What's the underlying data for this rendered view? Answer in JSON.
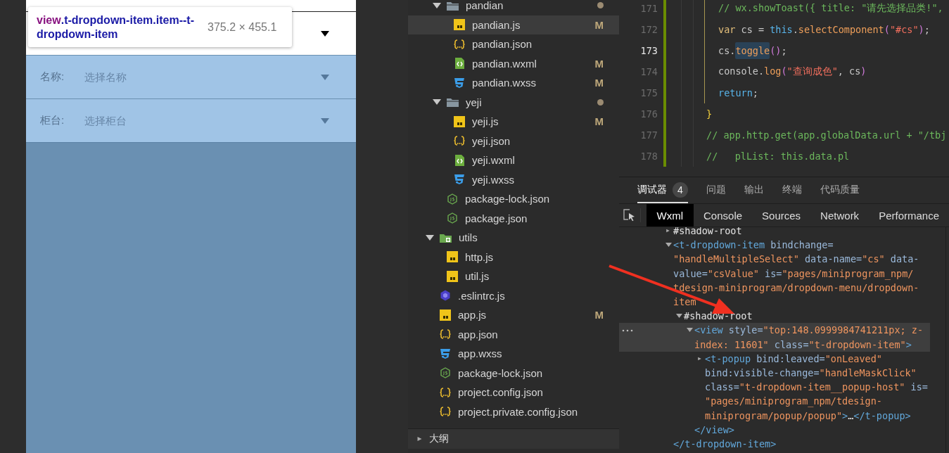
{
  "simulator": {
    "tooltip": {
      "tag": "view",
      "classes": ".t-dropdown-item.item--t-dropdown-item",
      "size": "375.2 × 455.1"
    },
    "fields": [
      {
        "label": "名称:",
        "placeholder": "选择名称"
      },
      {
        "label": "柜台:",
        "placeholder": "选择柜台"
      }
    ]
  },
  "file_tree": {
    "nested_items": [
      {
        "name": "pandian",
        "kind": "folder",
        "expanded": true,
        "modified": true,
        "selected": false,
        "children": [
          {
            "name": "pandian.js",
            "kind": "js",
            "status": "M",
            "selected": true
          },
          {
            "name": "pandian.json",
            "kind": "json",
            "selected": false
          },
          {
            "name": "pandian.wxml",
            "kind": "wxml",
            "status": "M",
            "selected": false
          },
          {
            "name": "pandian.wxss",
            "kind": "wxss",
            "status": "M",
            "selected": false
          }
        ]
      },
      {
        "name": "yeji",
        "kind": "folder",
        "expanded": true,
        "modified": true,
        "selected": false,
        "children": [
          {
            "name": "yeji.js",
            "kind": "js",
            "status": "M",
            "selected": false
          },
          {
            "name": "yeji.json",
            "kind": "json",
            "selected": false
          },
          {
            "name": "yeji.wxml",
            "kind": "wxml",
            "selected": false
          },
          {
            "name": "yeji.wxss",
            "kind": "wxss",
            "selected": false
          }
        ]
      },
      {
        "name": "package-lock.json",
        "kind": "node",
        "selected": false
      },
      {
        "name": "package.json",
        "kind": "node",
        "selected": false
      }
    ],
    "root_items": [
      {
        "name": "utils",
        "kind": "library-folder",
        "expanded": true,
        "modified": false,
        "selected": false,
        "children": [
          {
            "name": "http.js",
            "kind": "js",
            "selected": false
          },
          {
            "name": "util.js",
            "kind": "js",
            "selected": false
          }
        ]
      },
      {
        "name": ".eslintrc.js",
        "kind": "eslint",
        "selected": false
      },
      {
        "name": "app.js",
        "kind": "js",
        "status": "M",
        "selected": false
      },
      {
        "name": "app.json",
        "kind": "json",
        "selected": false
      },
      {
        "name": "app.wxss",
        "kind": "wxss",
        "selected": false
      },
      {
        "name": "package-lock.json",
        "kind": "node",
        "selected": false
      },
      {
        "name": "project.config.json",
        "kind": "json",
        "selected": false
      },
      {
        "name": "project.private.config.json",
        "kind": "json",
        "selected": false
      }
    ],
    "outline": {
      "label": "大纲",
      "expanded": false
    }
  },
  "editor": {
    "lines": [
      {
        "number": "171",
        "current": false,
        "kind": "inner",
        "tokens": [
          {
            "kind": "comment",
            "text": "// wx.showToast({ title: \"请先选择品类!\","
          }
        ]
      },
      {
        "number": "172",
        "current": false,
        "kind": "inner",
        "tokens": [
          {
            "kind": "keyword",
            "text": "var"
          },
          {
            "kind": "plain",
            "text": " cs = "
          },
          {
            "kind": "this",
            "text": "this"
          },
          {
            "kind": "plain",
            "text": "."
          },
          {
            "kind": "func",
            "text": "selectComponent"
          },
          {
            "kind": "paren",
            "text": "("
          },
          {
            "kind": "string",
            "text": "\"#cs\""
          },
          {
            "kind": "paren",
            "text": ")"
          },
          {
            "kind": "plain",
            "text": ";"
          }
        ]
      },
      {
        "number": "173",
        "current": true,
        "kind": "inner",
        "tokens": [
          {
            "kind": "plain",
            "text": "cs."
          },
          {
            "kind": "match",
            "text": "toggle"
          },
          {
            "kind": "paren",
            "text": "()"
          },
          {
            "kind": "plain",
            "text": ";"
          }
        ]
      },
      {
        "number": "174",
        "current": false,
        "kind": "inner",
        "tokens": [
          {
            "kind": "plain",
            "text": "console."
          },
          {
            "kind": "func",
            "text": "log"
          },
          {
            "kind": "paren",
            "text": "("
          },
          {
            "kind": "string",
            "text": "\"查询成色\""
          },
          {
            "kind": "plain",
            "text": ", cs"
          },
          {
            "kind": "paren",
            "text": ")"
          }
        ]
      },
      {
        "number": "175",
        "current": false,
        "kind": "inner",
        "tokens": [
          {
            "kind": "this",
            "text": "return"
          },
          {
            "kind": "plain",
            "text": ";"
          }
        ]
      },
      {
        "number": "176",
        "current": false,
        "kind": "outer",
        "tokens": [
          {
            "kind": "brace",
            "text": "}"
          }
        ]
      },
      {
        "number": "177",
        "current": false,
        "kind": "outer",
        "tokens": [
          {
            "kind": "comment",
            "text": "// app.http.get(app.globalData.url + \"/tbj"
          }
        ]
      },
      {
        "number": "178",
        "current": false,
        "kind": "outer",
        "tokens": [
          {
            "kind": "comment",
            "text": "//   plList: this.data.pl"
          }
        ]
      }
    ]
  },
  "devtools": {
    "panel_tabs": [
      {
        "label": "调试器",
        "badge": "4",
        "selected": true
      },
      {
        "label": "问题",
        "selected": false
      },
      {
        "label": "输出",
        "selected": false
      },
      {
        "label": "终端",
        "selected": false
      },
      {
        "label": "代码质量",
        "selected": false
      }
    ],
    "tool_tabs": [
      {
        "label": "Wxml",
        "selected": true
      },
      {
        "label": "Console",
        "selected": false
      },
      {
        "label": "Sources",
        "selected": false
      },
      {
        "label": "Network",
        "selected": false
      },
      {
        "label": "Performance",
        "selected": false
      }
    ],
    "dom_tree": [
      {
        "expanded": false,
        "selected": false,
        "tokens": [
          {
            "kind": "text",
            "text": "#shadow-root"
          }
        ]
      },
      {
        "expanded": true,
        "selected": false,
        "tokens": [
          {
            "kind": "tag",
            "text": "<t-dropdown-item"
          },
          {
            "kind": "attr",
            "text": " bindchange="
          },
          {
            "kind": "value",
            "text": "\"handleMultipleSelect\""
          },
          {
            "kind": "attr",
            "text": " data-name="
          },
          {
            "kind": "value",
            "text": "\"cs\""
          },
          {
            "kind": "attr",
            "text": " data-value="
          },
          {
            "kind": "value",
            "text": "\"csValue\""
          },
          {
            "kind": "attr",
            "text": " is="
          },
          {
            "kind": "value",
            "text": "\"pages/miniprogram_npm/"
          },
          {
            "kind": "value",
            "text": "tdesign-miniprogram/dropdown-menu/dropdown-item"
          }
        ],
        "children": [
          {
            "expanded": true,
            "selected": false,
            "tokens": [
              {
                "kind": "text",
                "text": "#shadow-root"
              }
            ],
            "children": [
              {
                "expanded": true,
                "selected": true,
                "tokens": [
                  {
                    "kind": "tag",
                    "text": "<view"
                  },
                  {
                    "kind": "attr",
                    "text": " style="
                  },
                  {
                    "kind": "value",
                    "text": "\"top:148.0999984741211px; z-index: 11601\""
                  },
                  {
                    "kind": "attr",
                    "text": " class="
                  },
                  {
                    "kind": "value",
                    "text": "\"t-dropdown-item\""
                  },
                  {
                    "kind": "tag",
                    "text": ">"
                  }
                ],
                "children": [
                  {
                    "expanded": false,
                    "selected": false,
                    "tokens": [
                      {
                        "kind": "tag",
                        "text": "<t-popup"
                      },
                      {
                        "kind": "attr",
                        "text": " bind:leaved="
                      },
                      {
                        "kind": "value",
                        "text": "\"onLeaved\""
                      },
                      {
                        "kind": "attr",
                        "text": " bind:visible-change="
                      },
                      {
                        "kind": "value",
                        "text": "\"handleMaskClick\""
                      },
                      {
                        "kind": "attr",
                        "text": " class="
                      },
                      {
                        "kind": "value",
                        "text": "\"t-dropdown-item__popup-host\""
                      },
                      {
                        "kind": "attr",
                        "text": " is="
                      },
                      {
                        "kind": "value",
                        "text": "\"pages/miniprogram_npm/tdesign-miniprogram/popup/popup\""
                      },
                      {
                        "kind": "tag",
                        "text": ">"
                      },
                      {
                        "kind": "text",
                        "text": "…"
                      },
                      {
                        "kind": "tag",
                        "text": "</t-popup>"
                      }
                    ]
                  }
                ],
                "closing": [
                  {
                    "kind": "tag",
                    "text": "</view>"
                  }
                ]
              }
            ]
          }
        ],
        "closing": [
          {
            "kind": "tag",
            "text": "</t-dropdown-item>"
          }
        ]
      }
    ]
  }
}
